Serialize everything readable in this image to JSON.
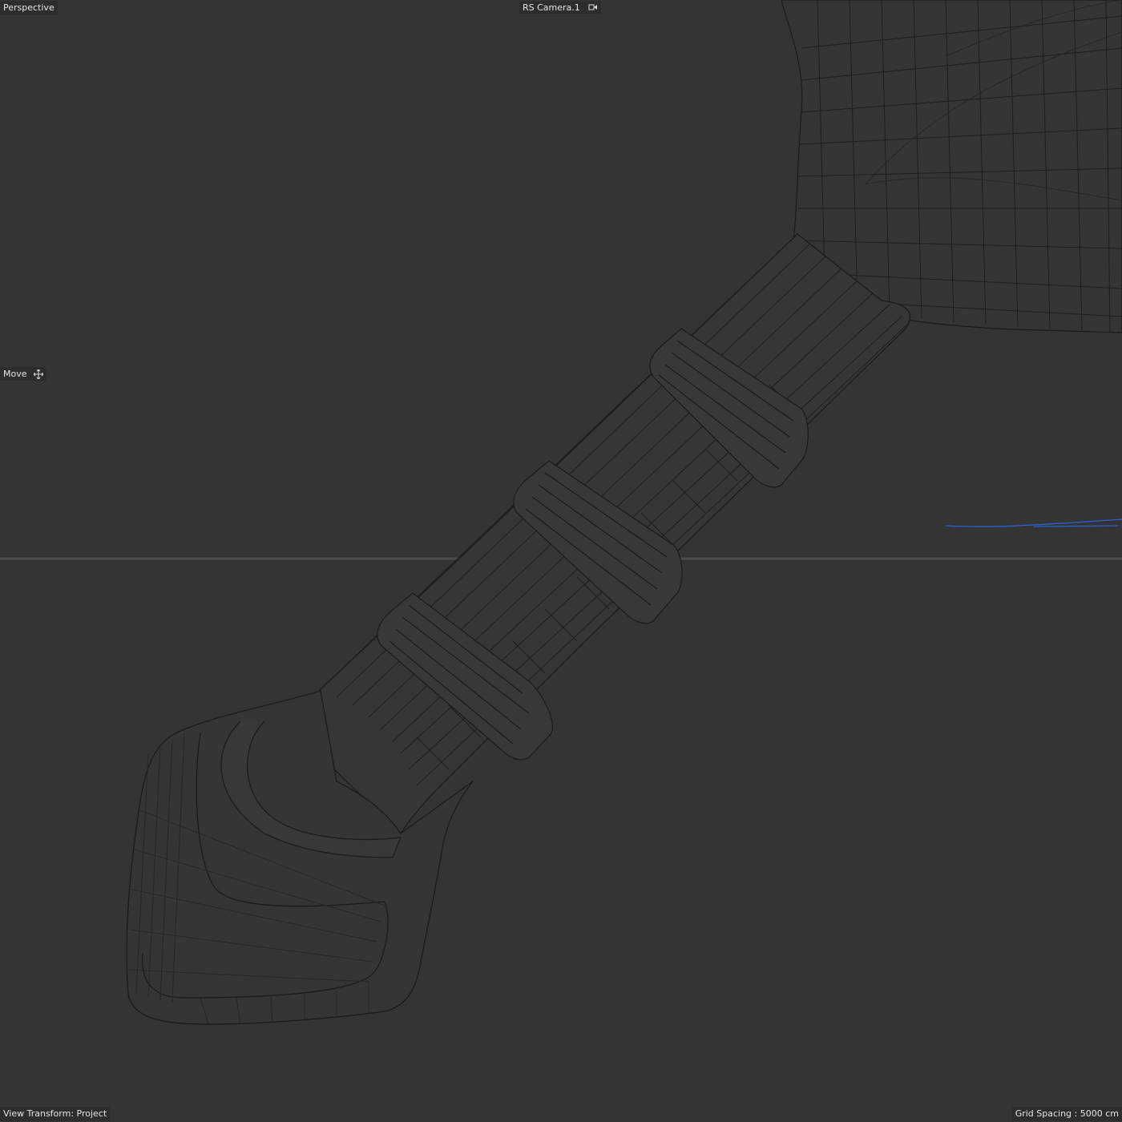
{
  "viewport": {
    "view_name": "Perspective",
    "camera_name": "RS Camera.1",
    "active_tool": "Move",
    "view_transform": "View Transform: Project",
    "grid_spacing": "Grid Spacing : 5000 cm"
  },
  "icons": {
    "camera": "camera-icon",
    "move": "move-icon"
  },
  "colors": {
    "background": "#343434",
    "wire": "#1c1c1c",
    "horizon": "#4a4a4a",
    "spline": "#2f5fd0",
    "hud_text": "#e6e6e6"
  }
}
